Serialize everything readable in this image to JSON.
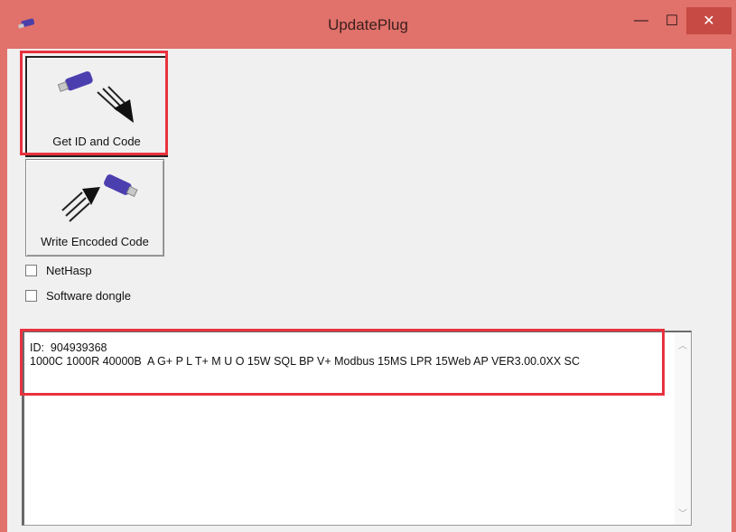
{
  "window": {
    "title": "UpdatePlug",
    "minimize_glyph": "—",
    "maximize_glyph": "☐",
    "close_glyph": "✕"
  },
  "buttons": {
    "get_id": {
      "label": "Get ID and Code",
      "icon": "usb-read-icon"
    },
    "write_code": {
      "label": "Write Encoded Code",
      "icon": "usb-write-icon"
    }
  },
  "checkboxes": [
    {
      "label": "NetHasp",
      "checked": false
    },
    {
      "label": "Software dongle",
      "checked": false
    }
  ],
  "output": {
    "text": "ID:  904939368\n1000C 1000R 40000B  A G+ P L T+ M U O 15W SQL BP V+ Modbus 15MS LPR 15Web AP VER3.00.0XX SC"
  },
  "colors": {
    "titlebar": "#e0716b",
    "highlight": "#e8323f",
    "close_button": "#c74a45"
  }
}
